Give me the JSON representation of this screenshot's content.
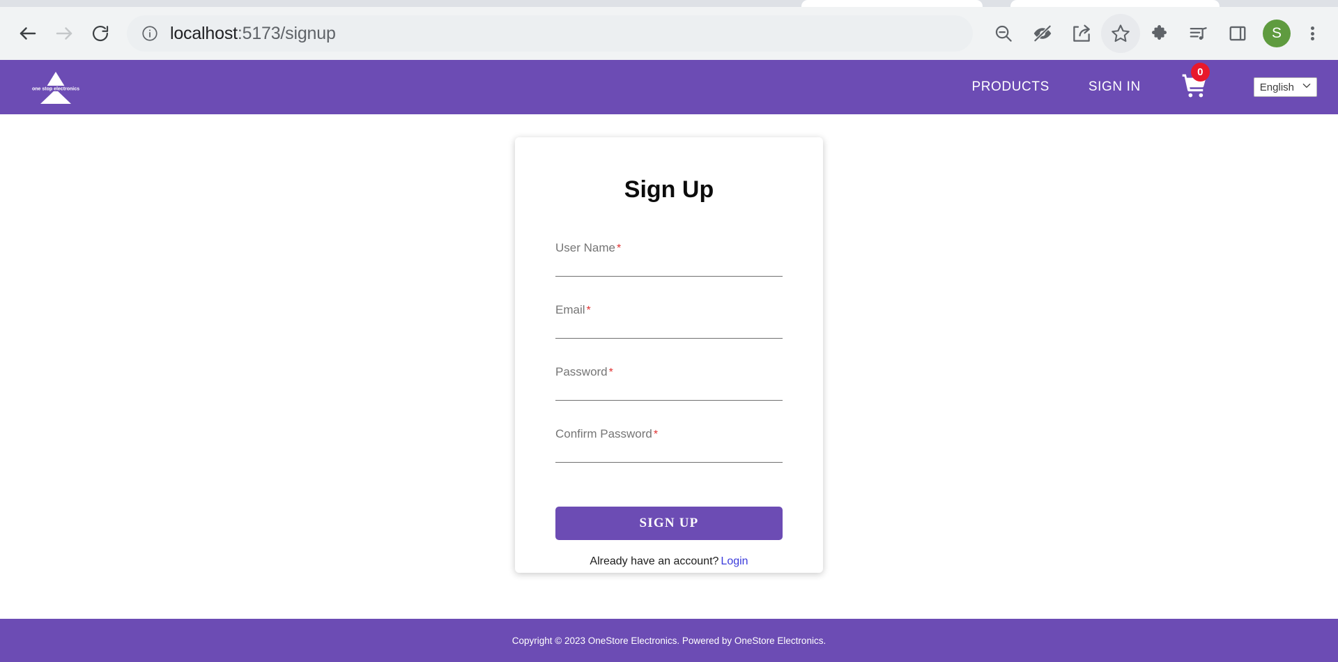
{
  "browser": {
    "back_icon": "back-arrow-icon",
    "forward_icon": "forward-arrow-icon",
    "reload_icon": "reload-icon",
    "site_info_icon": "info-circle-icon",
    "url_host": "localhost",
    "url_path": ":5173/signup",
    "toolbar_icons": [
      "zoom-out-icon",
      "eye-slash-icon",
      "share-icon",
      "bookmark-star-icon",
      "extensions-puzzle-icon",
      "media-playlist-icon",
      "side-panel-icon"
    ],
    "profile_initial": "S",
    "menu_icon": "three-dot-menu-icon"
  },
  "navbar": {
    "logo_text": "one stop electronics",
    "links": [
      {
        "label": "PRODUCTS"
      },
      {
        "label": "SIGN IN"
      }
    ],
    "cart_icon": "shopping-cart-icon",
    "cart_count": "0",
    "language": "English",
    "chevron_icon": "chevron-down-icon",
    "background_color": "#6c4cb4"
  },
  "signup": {
    "title": "Sign Up",
    "fields": [
      {
        "label": "User Name",
        "required": "*",
        "value": "",
        "placeholder": ""
      },
      {
        "label": "Email",
        "required": "*",
        "value": "",
        "placeholder": ""
      },
      {
        "label": "Password",
        "required": "*",
        "value": "",
        "placeholder": ""
      },
      {
        "label": "Confirm Password",
        "required": "*",
        "value": "",
        "placeholder": ""
      }
    ],
    "submit_label": "SIGN UP",
    "account_prompt": "Already have an account?",
    "login_label": "Login",
    "link_color": "#3b3bdb",
    "accent_color": "#6c4cb4",
    "required_color": "#e03131"
  },
  "footer": {
    "text": "Copyright © 2023 OneStore Electronics. Powered by OneStore Electronics."
  }
}
